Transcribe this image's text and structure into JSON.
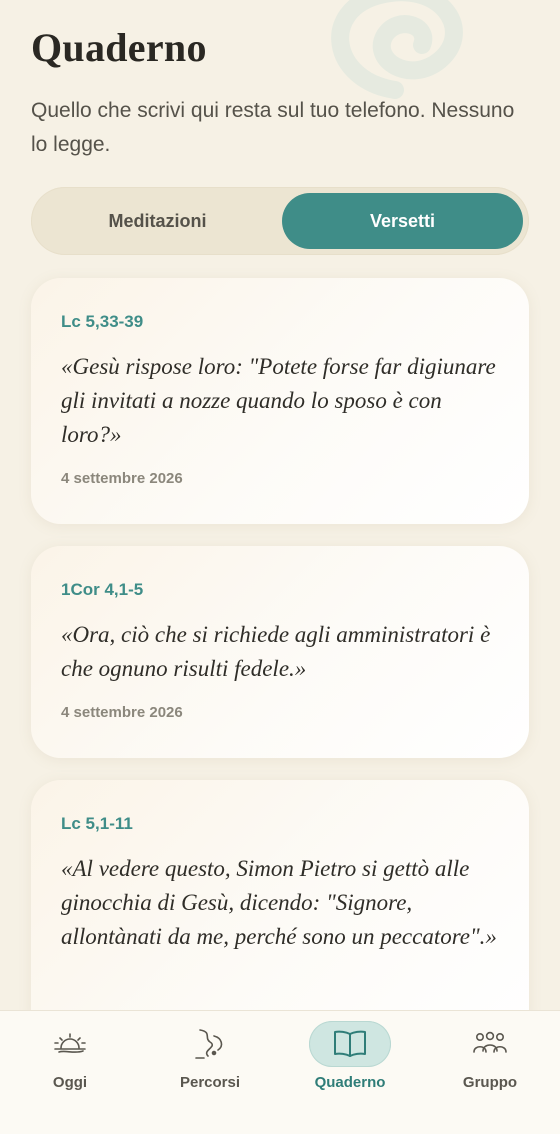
{
  "header": {
    "title": "Quaderno",
    "subtitle": "Quello che scrivi qui resta sul tuo telefono. Nessuno lo legge."
  },
  "segmented": {
    "left_label": "Meditazioni",
    "right_label": "Versetti",
    "selected": "Versetti"
  },
  "entries": [
    {
      "ref": "Lc 5,33-39",
      "text": "«Gesù rispose loro: \"Potete forse far digiunare gli invitati a nozze quando lo sposo è con loro?»",
      "date": "4 settembre 2026"
    },
    {
      "ref": "1Cor 4,1-5",
      "text": "«Ora, ciò che si richiede agli amministratori è che ognuno risulti fedele.»",
      "date": "4 settembre 2026"
    },
    {
      "ref": "Lc 5,1-11",
      "text": "«Al vedere questo, Simon Pietro si gettò alle ginocchia di Gesù, dicendo: \"Signore, allontànati da me, perché sono un peccatore\".»",
      "date": ""
    }
  ],
  "tabs": [
    {
      "label": "Oggi",
      "icon": "sunrise-icon"
    },
    {
      "label": "Percorsi",
      "icon": "path-icon"
    },
    {
      "label": "Quaderno",
      "icon": "book-icon",
      "active": true
    },
    {
      "label": "Gruppo",
      "icon": "group-icon"
    }
  ],
  "colors": {
    "accent": "#3f8d88",
    "background": "#f6f1e5",
    "active_tab_bg": "#cfe6e1"
  }
}
